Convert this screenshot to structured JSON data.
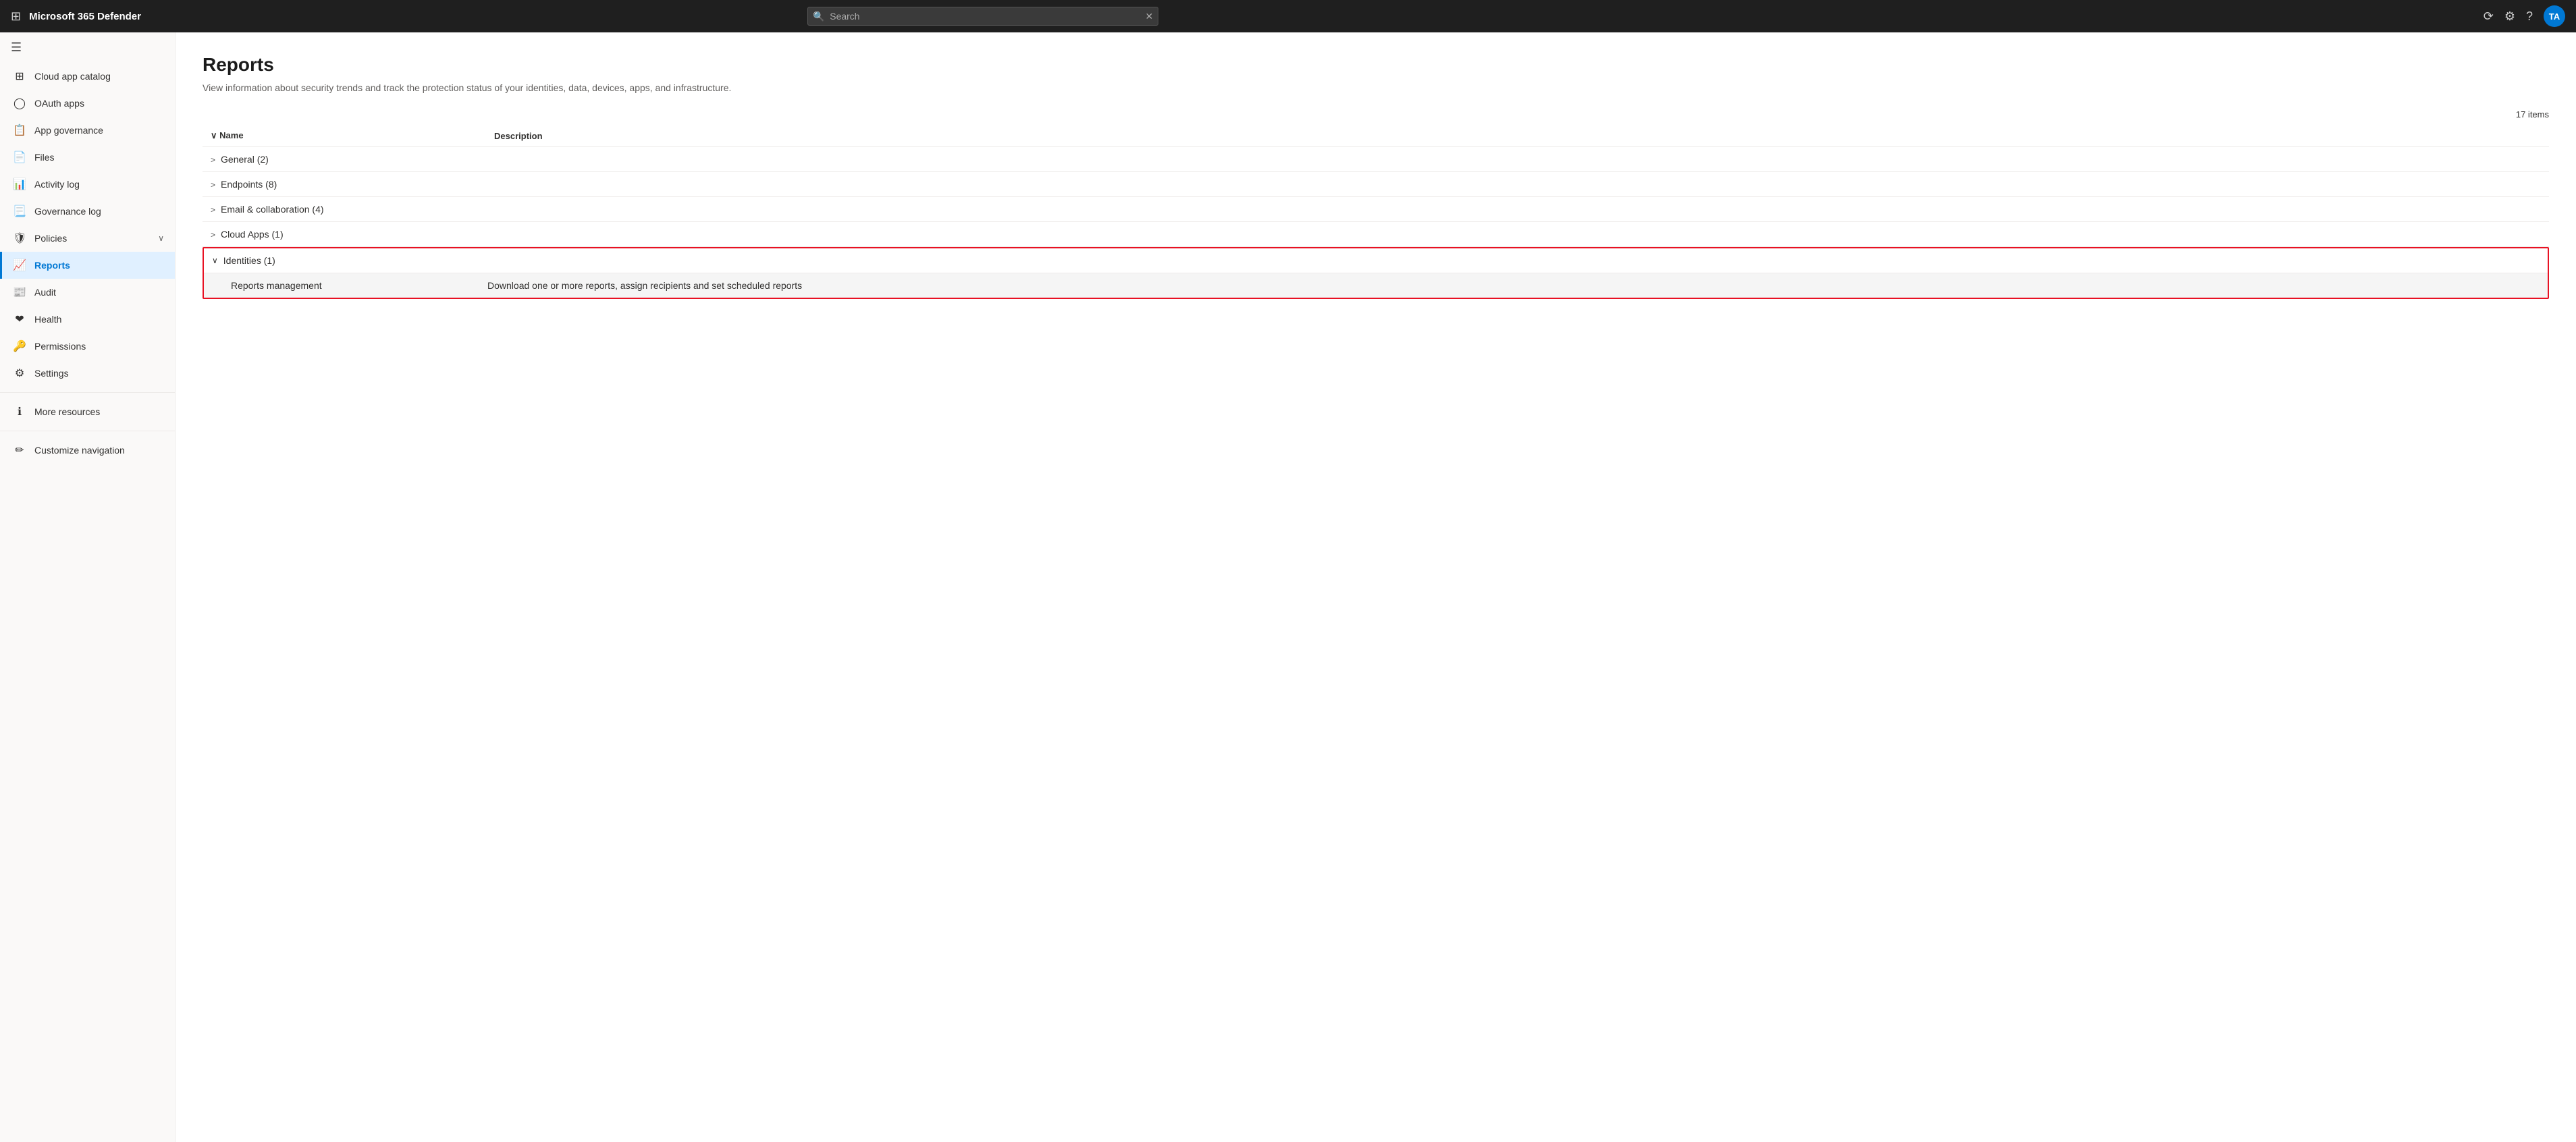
{
  "app": {
    "title": "Microsoft 365 Defender"
  },
  "topbar": {
    "search_placeholder": "Search",
    "avatar_initials": "TA"
  },
  "sidebar": {
    "toggle_label": "Collapse navigation",
    "items": [
      {
        "id": "cloud-app-catalog",
        "label": "Cloud app catalog",
        "icon": "grid"
      },
      {
        "id": "oauth-apps",
        "label": "OAuth apps",
        "icon": "id-badge"
      },
      {
        "id": "app-governance",
        "label": "App governance",
        "icon": "governance"
      },
      {
        "id": "files",
        "label": "Files",
        "icon": "file"
      },
      {
        "id": "activity-log",
        "label": "Activity log",
        "icon": "activity"
      },
      {
        "id": "governance-log",
        "label": "Governance log",
        "icon": "gov-log"
      },
      {
        "id": "policies",
        "label": "Policies",
        "icon": "policy",
        "has_chevron": true
      },
      {
        "id": "reports",
        "label": "Reports",
        "icon": "report",
        "active": true
      },
      {
        "id": "audit",
        "label": "Audit",
        "icon": "audit"
      },
      {
        "id": "health",
        "label": "Health",
        "icon": "health"
      },
      {
        "id": "permissions",
        "label": "Permissions",
        "icon": "permissions"
      },
      {
        "id": "settings",
        "label": "Settings",
        "icon": "settings"
      },
      {
        "id": "more-resources",
        "label": "More resources",
        "icon": "more"
      },
      {
        "id": "customize-navigation",
        "label": "Customize navigation",
        "icon": "customize"
      }
    ]
  },
  "main": {
    "title": "Reports",
    "description": "View information about security trends and track the protection status of your identities, data, devices, apps, and infrastructure.",
    "items_count": "17 items",
    "table": {
      "col_name": "Name",
      "col_description": "Description",
      "groups": [
        {
          "id": "general",
          "label": "General (2)",
          "expanded": false,
          "highlighted": false,
          "children": []
        },
        {
          "id": "endpoints",
          "label": "Endpoints (8)",
          "expanded": false,
          "highlighted": false,
          "children": []
        },
        {
          "id": "email-collaboration",
          "label": "Email & collaboration (4)",
          "expanded": false,
          "highlighted": false,
          "children": []
        },
        {
          "id": "cloud-apps",
          "label": "Cloud Apps (1)",
          "expanded": false,
          "highlighted": false,
          "children": []
        },
        {
          "id": "identities",
          "label": "Identities (1)",
          "expanded": true,
          "highlighted": true,
          "children": [
            {
              "id": "reports-management",
              "name": "Reports management",
              "description": "Download one or more reports, assign recipients and set scheduled reports"
            }
          ]
        }
      ]
    }
  }
}
